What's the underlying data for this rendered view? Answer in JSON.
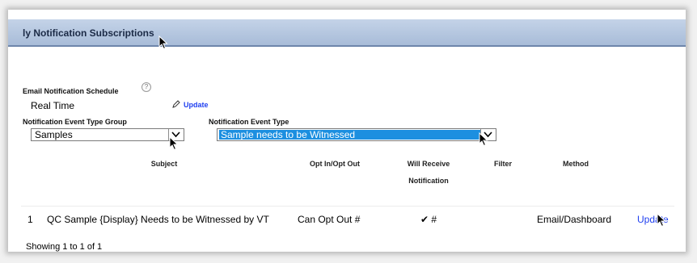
{
  "header": {
    "title": "ly Notification Subscriptions"
  },
  "schedule": {
    "label": "Email Notification Schedule",
    "help_glyph": "?",
    "value": "Real Time",
    "update_label": "Update",
    "pencil_icon": "pencil-icon"
  },
  "filters": {
    "group_label": "Notification Event Type Group",
    "group_value": "Samples",
    "type_label": "Notification Event Type",
    "type_value": "Sample needs to be Witnessed"
  },
  "table": {
    "columns": [
      "Subject",
      "Opt In/Opt Out",
      "Will Receive",
      "Notification",
      "Filter",
      "Method"
    ],
    "rows": [
      {
        "index": "1",
        "subject": "QC Sample {Display} Needs to be Witnessed by VT",
        "opt": "Can Opt Out #",
        "receive": "✔ #",
        "filter": "",
        "method": "Email/Dashboard",
        "action": "Update"
      }
    ]
  },
  "footer": {
    "showing": "Showing 1 to 1 of 1"
  },
  "colors": {
    "header_bar": "#b3c5de",
    "link": "#1f3ff0",
    "selection": "#1c8fe0"
  }
}
